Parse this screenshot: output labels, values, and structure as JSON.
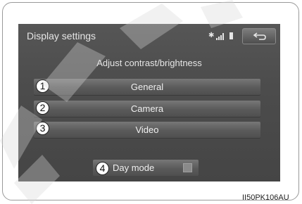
{
  "header": {
    "title": "Display settings",
    "status_icons": [
      "bluetooth-icon",
      "signal-strength-icon",
      "battery-icon"
    ],
    "back_icon": "back-arrow-icon"
  },
  "main": {
    "subtitle": "Adjust contrast/brightness",
    "buttons": [
      {
        "label": "General",
        "callout": "1"
      },
      {
        "label": "Camera",
        "callout": "2"
      },
      {
        "label": "Video",
        "callout": "3"
      }
    ],
    "day_mode": {
      "label": "Day mode",
      "callout": "4",
      "indicator_on": false
    }
  },
  "caption": "II50PK106AU",
  "colors": {
    "screen_bg": "#4c4c4c",
    "button_bg": "#5a5a5a",
    "text": "#e6e6e6"
  }
}
